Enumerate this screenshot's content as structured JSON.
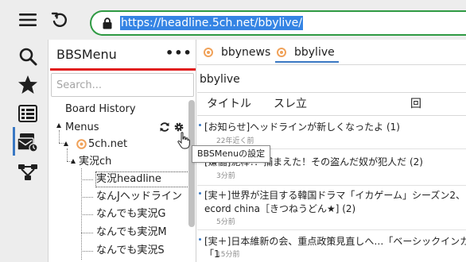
{
  "browser": {
    "url": "https://headline.5ch.net/bbylive/"
  },
  "rail": {
    "icons": [
      "search-icon",
      "star-icon",
      "list-icon",
      "bbs-menu-icon",
      "tree-icon"
    ],
    "active_index": 3
  },
  "bbs_menu": {
    "title": "BBSMenu",
    "more_label": "•••",
    "search_placeholder": "Search...",
    "tree": {
      "board_history": "Board History",
      "menus": "Menus",
      "site": "5ch.net",
      "category": "実況ch",
      "boards": [
        "実況headline",
        "なんJヘッドライン",
        "なんでも実況G",
        "なんでも実況M",
        "なんでも実況S"
      ]
    },
    "tooltip": "BBSMenuの設定"
  },
  "main": {
    "tabs": [
      {
        "label": "bbynews",
        "active": false
      },
      {
        "label": "bbylive",
        "active": true
      }
    ],
    "board_title": "bbylive",
    "columns": {
      "title": "タイトル",
      "res": "スレ立",
      "count": "回"
    },
    "threads": [
      {
        "title": "[お知らせ]ヘッドラインが新しくなったよ (1)",
        "age": "22年近く前"
      },
      {
        "title": "[嫌儲]泥棒!！捕まえた！その盗んだ奴が犯人だ (2)",
        "age": "3分前"
      },
      {
        "title": "[実＋]世界が注目する韓国ドラマ「イカゲーム」シーズン2、",
        "title2": "ecord china［きつねうどん★] (2)",
        "age": "5分前"
      },
      {
        "title": "[実＋]日本維新の会、重点政策見直しへ…「ベーシックインカ",
        "title2": "「1",
        "age": "15分前"
      }
    ]
  },
  "colors": {
    "url_border": "#2f9a43",
    "url_selection": "#3584e4",
    "menu_underline": "#e11d1d",
    "active_tab": "#3a78c3"
  }
}
